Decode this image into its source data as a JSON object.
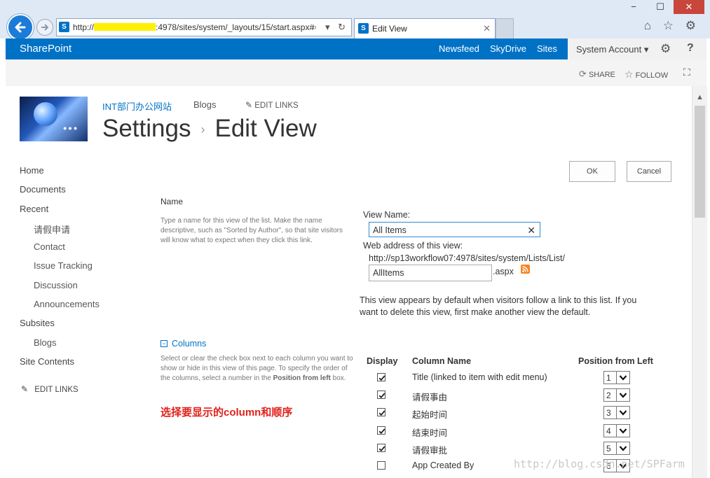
{
  "browser": {
    "address_prefix": "http://",
    "address_suffix": ":4978/sites/system/_layouts/15/start.aspx#",
    "address_icons": "⌕ ▾ ↻",
    "tab_title": "Edit View",
    "tab_close": "✕",
    "window_controls": [
      "−",
      "☐",
      "✕"
    ],
    "toolbar_icons": "⌂ ☆ ⚙"
  },
  "suitebar": {
    "brand": "SharePoint",
    "links": [
      "Newsfeed",
      "SkyDrive",
      "Sites"
    ],
    "account": "System Account ▾",
    "settings_icon": "⚙",
    "help_icon": "?"
  },
  "promoted": {
    "share": "SHARE",
    "follow": "FOLLOW"
  },
  "site": {
    "title_link": "INT部门办公网站",
    "blogs_link": "Blogs",
    "edit_links": "EDIT LINKS",
    "breadcrumb_parent": "Settings",
    "breadcrumb_sep": "›",
    "page_title": "Edit View"
  },
  "quicklaunch": {
    "items": [
      {
        "label": "Home"
      },
      {
        "label": "Documents"
      },
      {
        "label": "Recent"
      },
      {
        "label": "请假申请"
      },
      {
        "label": "Contact"
      },
      {
        "label": "Issue Tracking"
      },
      {
        "label": "Discussion"
      },
      {
        "label": "Announcements"
      },
      {
        "label": "Subsites"
      },
      {
        "label": "Blogs"
      },
      {
        "label": "Site Contents"
      }
    ],
    "edit_links": "EDIT LINKS"
  },
  "buttons": {
    "ok": "OK",
    "cancel": "Cancel"
  },
  "name_section": {
    "title": "Name",
    "description": "Type a name for this view of the list. Make the name descriptive, such as \"Sorted by Author\", so that site visitors will know what to expect when they click this link.",
    "view_name_label": "View Name:",
    "view_name_value": "All Items",
    "web_address_label": "Web address of this view:",
    "web_address_prefix": "http://sp13workflow07:4978/sites/system/Lists/List/",
    "url_value": "AllItems",
    "url_suffix": ".aspx",
    "default_note": "This view appears by default when visitors follow a link to this list. If you want to delete this view, first make another view the default."
  },
  "columns_section": {
    "title": "Columns",
    "collapse_icon": "−",
    "description_pre": "Select or clear the check box next to each column you want to show or hide in this view of this page. To specify the order of the columns, select a number in the ",
    "description_bold": "Position from left",
    "description_post": " box.",
    "headers": {
      "display": "Display",
      "column_name": "Column Name",
      "position": "Position from Left"
    },
    "rows": [
      {
        "checked": true,
        "name": "Title (linked to item with edit menu)",
        "position": "1"
      },
      {
        "checked": true,
        "name": "请假事由",
        "position": "2"
      },
      {
        "checked": true,
        "name": "起始时间",
        "position": "3"
      },
      {
        "checked": true,
        "name": "结束时间",
        "position": "4"
      },
      {
        "checked": true,
        "name": "请假审批",
        "position": "5"
      },
      {
        "checked": false,
        "name": "App Created By",
        "position": "6"
      }
    ]
  },
  "annotation": "选择要显示的column和顺序",
  "watermark": "http://blog.csdn.net/SPFarm",
  "colors": {
    "accent": "#0072c6",
    "annotation": "#e0211a"
  }
}
